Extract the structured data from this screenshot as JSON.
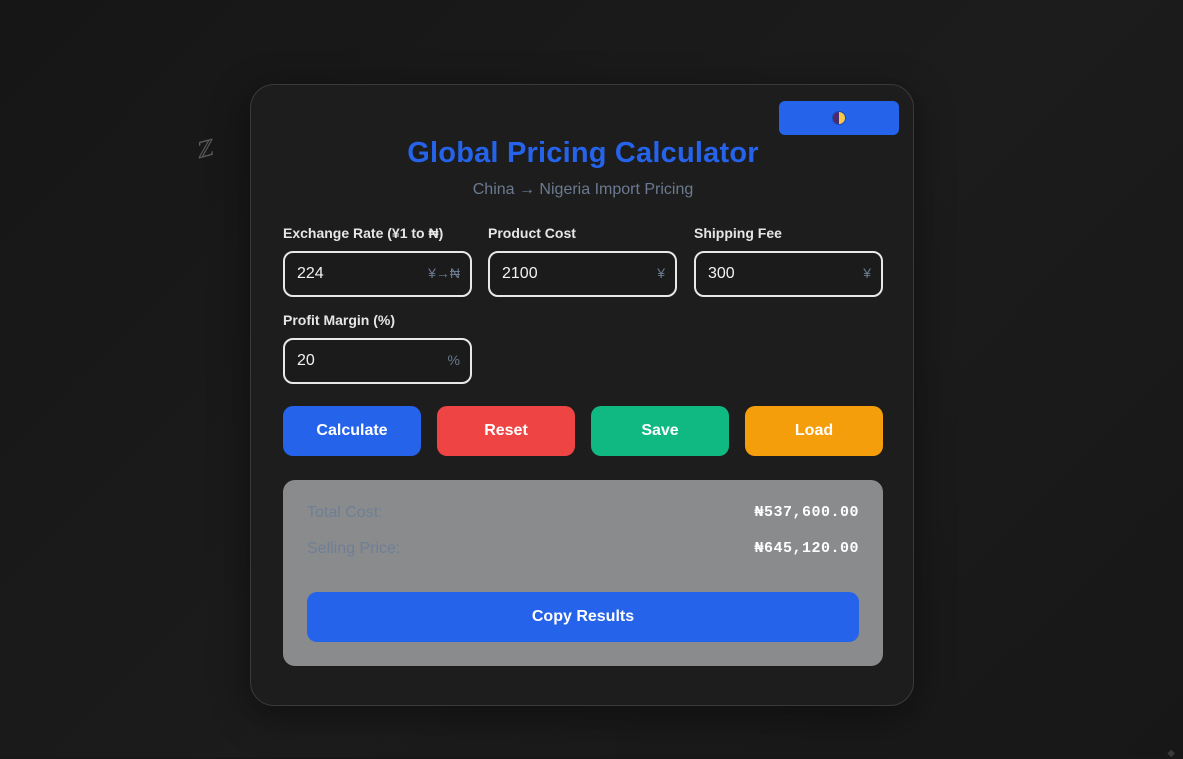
{
  "app": {
    "title": "Global Pricing Calculator",
    "subtitle": "China → Nigeria Import Pricing"
  },
  "theme_toggle": {
    "icon": "half-moon-icon"
  },
  "decor": {
    "glyph": "ℤ",
    "corner_glyph": "◆"
  },
  "fields": {
    "exchange_rate": {
      "label": "Exchange Rate (¥1 to ₦)",
      "value": "224",
      "unit": "¥→₦"
    },
    "product_cost": {
      "label": "Product Cost",
      "value": "2100",
      "unit": "¥"
    },
    "shipping_fee": {
      "label": "Shipping Fee",
      "value": "300",
      "unit": "¥"
    },
    "profit_margin": {
      "label": "Profit Margin (%)",
      "value": "20",
      "unit": "%"
    }
  },
  "buttons": {
    "calculate": "Calculate",
    "reset": "Reset",
    "save": "Save",
    "load": "Load",
    "copy_results": "Copy Results"
  },
  "results": {
    "total_cost_label": "Total Cost:",
    "total_cost_value": "₦537,600.00",
    "selling_price_label": "Selling Price:",
    "selling_price_value": "₦645,120.00"
  },
  "colors": {
    "accent": "#2563eb",
    "reset": "#ef4444",
    "save": "#10b981",
    "load": "#f59e0b",
    "results_panel": "#8a8b8d"
  }
}
